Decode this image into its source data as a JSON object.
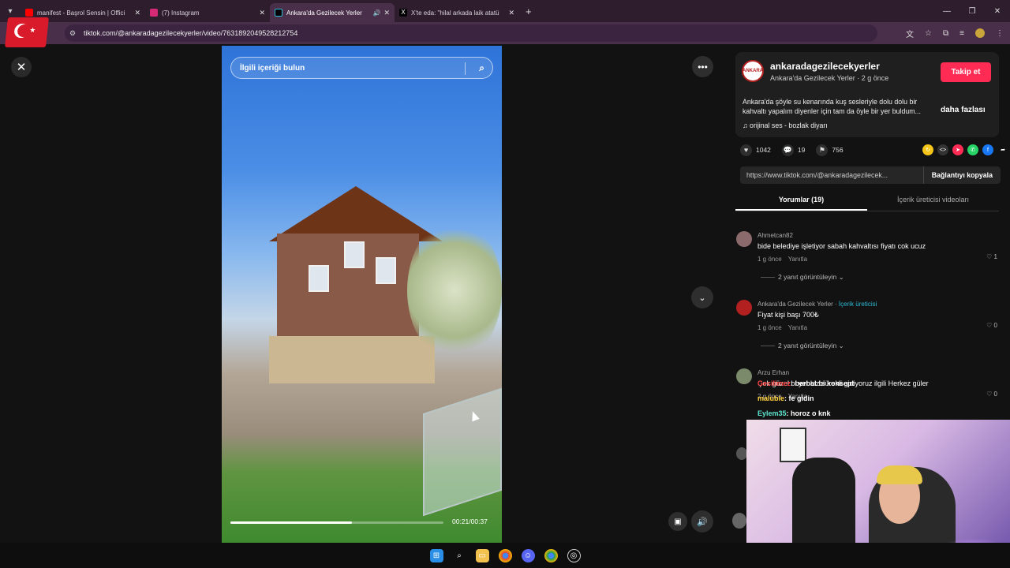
{
  "browser": {
    "tabs": [
      {
        "title": "manifest - Başrol Sensin | Offici",
        "favicon_color": "#ff0000",
        "active": false
      },
      {
        "title": "(7) Instagram",
        "favicon_color": "#d62976",
        "active": false
      },
      {
        "title": "Ankara'da Gezilecek Yerler",
        "favicon_color": "#000000",
        "active": true
      },
      {
        "title": "X'te eda: \"hilal arkada laik atatü",
        "favicon_color": "#000000",
        "active": false
      }
    ],
    "url": "tiktok.com/@ankaradagezilecekyerler/video/7631892049528212754"
  },
  "video": {
    "search_placeholder": "İlgili içeriği bulun",
    "time": "00:21/00:37",
    "progress": 0.57
  },
  "post": {
    "username": "ankaradagezilecekyerler",
    "subtitle": "Ankara'da Gezilecek Yerler · 2 g önce",
    "follow_label": "Takip et",
    "description": "Ankara'da şöyle su kenarında kuş sesleriyle dolu dolu bir kahvaltı yapalım diyenler için tam da öyle bir yer buldum...",
    "more_label": "daha fazlası",
    "music": "orijinal ses - bozlak diyarı",
    "likes": "1042",
    "comments": "19",
    "saves": "756",
    "link": "https://www.tiktok.com/@ankaradagezilecek...",
    "copy_label": "Bağlantıyı kopyala",
    "tab_comments": "Yorumlar (19)",
    "tab_creator": "İçerik üreticisi videoları"
  },
  "comments": [
    {
      "user": "Ahmetcan82",
      "tag": "",
      "text": "bide belediye işletiyor sabah kahvaltısı fiyatı cok ucuz",
      "time": "1 g önce",
      "reply": "Yanıtla",
      "likes": "1",
      "replies": "2 yanıt görüntüleyin"
    },
    {
      "user": "Ankara'da Gezilecek Yerler · ",
      "tag": "İçerik üreticisi",
      "text": "Fiyat kişi başı 700₺",
      "time": "1 g önce",
      "reply": "Yanıtla",
      "likes": "0",
      "replies": "2 yanıt görüntüleyin"
    },
    {
      "user": "Arzu Erhan",
      "tag": "",
      "text": "Çok güzel bi yer biz sürekli gidiyoruz ilgili Herkez güler",
      "time": "2 g önce",
      "reply": "Yanıtla",
      "likes": "0",
      "replies": ""
    }
  ],
  "chat": [
    {
      "name": "Gecilimez",
      "msg": ": berbat bi konsept"
    },
    {
      "name": "malubie",
      "msg": ": fe gidin"
    },
    {
      "name": "Eylem35",
      "msg": ": horoz o knk"
    }
  ],
  "colors": {
    "accent": "#fe2c55",
    "creator_tag": "#2bbcd6"
  }
}
